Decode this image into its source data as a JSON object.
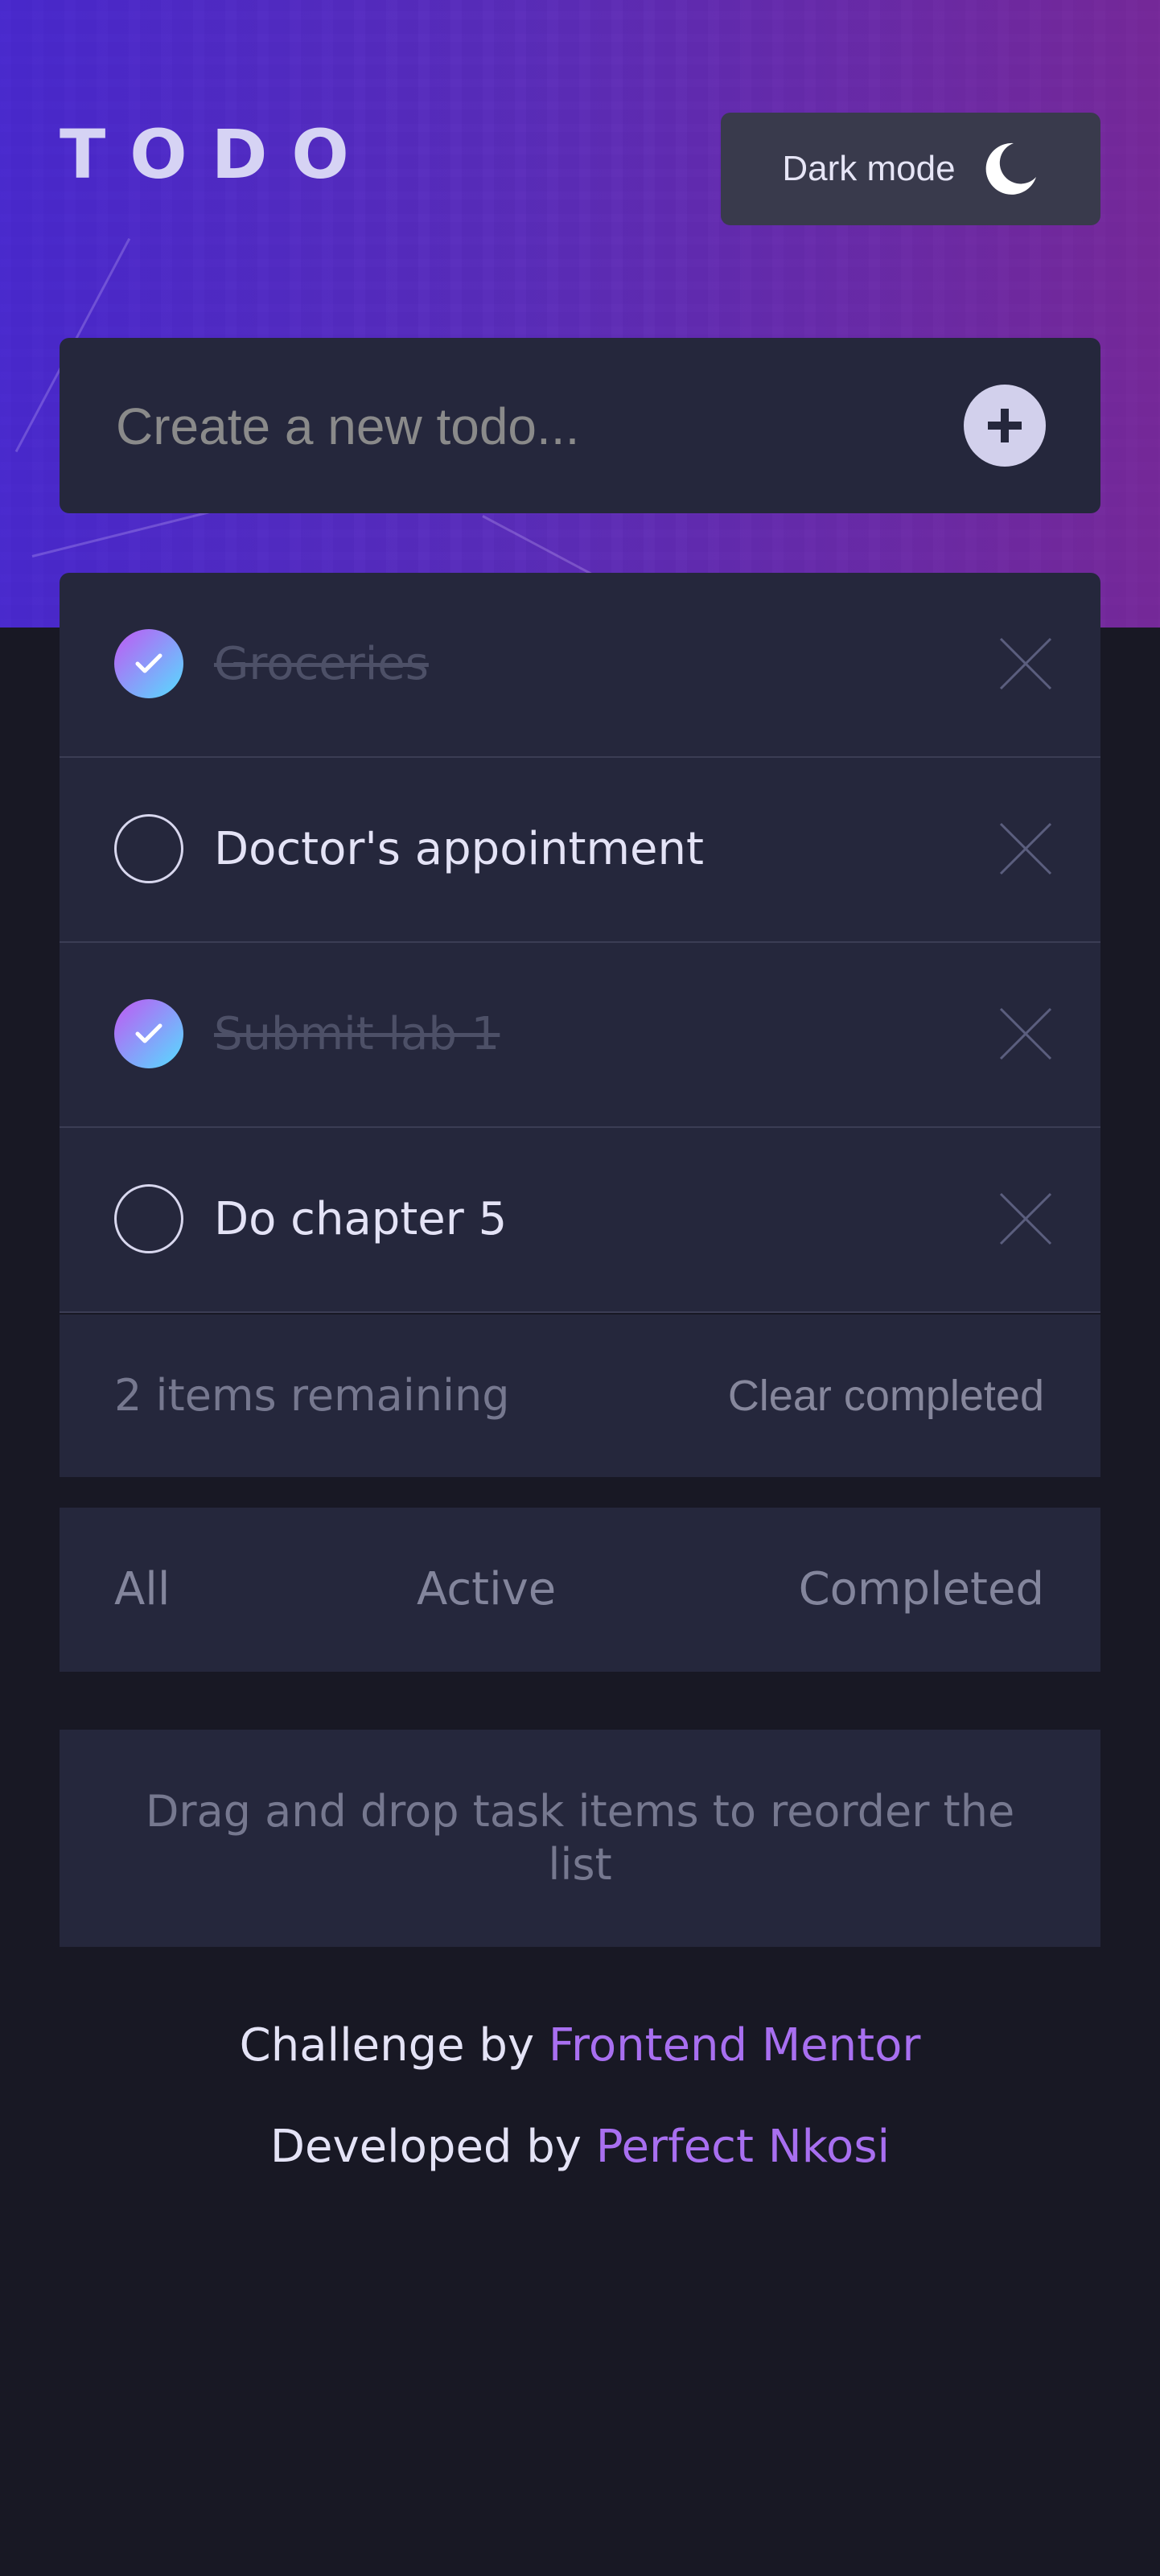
{
  "header": {
    "logo": "TODO",
    "mode_toggle_label": "Dark mode"
  },
  "new_todo": {
    "placeholder": "Create a new todo..."
  },
  "todos": [
    {
      "text": "Groceries",
      "completed": true
    },
    {
      "text": "Doctor's appointment",
      "completed": false
    },
    {
      "text": "Submit lab 1",
      "completed": true
    },
    {
      "text": "Do chapter 5",
      "completed": false
    }
  ],
  "list_footer": {
    "remaining": "2 items remaining",
    "clear_completed": "Clear completed"
  },
  "filters": {
    "all": "All",
    "active": "Active",
    "completed": "Completed"
  },
  "hint": "Drag and drop task items to reorder the list",
  "credits": {
    "challenge_prefix": "Challenge by",
    "challenge_link": "Frontend Mentor",
    "developer_prefix": "Developed by",
    "developer_link": "Perfect Nkosi"
  },
  "colors": {
    "background": "#181824",
    "card": "#25273c",
    "accent_link": "#a86ff0",
    "check_gradient_start": "#c058f3",
    "check_gradient_end": "#55ddff"
  },
  "icons": {
    "mode": "moon-icon",
    "add": "plus-icon",
    "delete": "close-icon",
    "check": "checkmark-icon"
  }
}
